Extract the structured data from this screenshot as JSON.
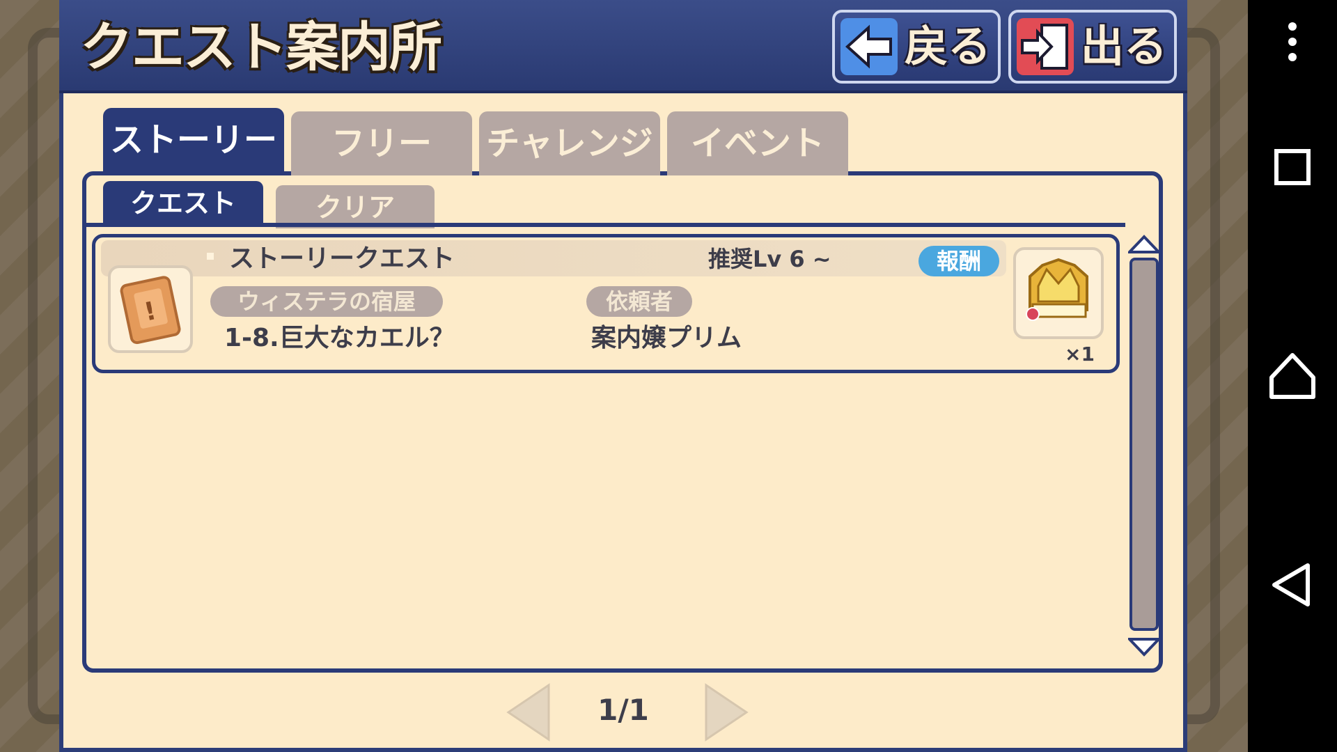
{
  "header": {
    "title": "クエスト案内所",
    "back_label": "戻る",
    "exit_label": "出る"
  },
  "tabs": [
    "ストーリー",
    "フリー",
    "チャレンジ",
    "イベント"
  ],
  "subtabs": [
    "クエスト",
    "クリア"
  ],
  "quests": [
    {
      "type": "ストーリークエスト",
      "recommended_level": "推奨Lv 6 ~",
      "reward_label": "報酬",
      "location": "ウィステラの宿屋",
      "client_label": "依頼者",
      "name": "1-8.巨大なカエル？",
      "client": "案内嬢プリム",
      "reward_count": "×1"
    }
  ],
  "pager": {
    "label": "1/1"
  },
  "colors": {
    "panel_bg": "#fdebc9",
    "accent_navy": "#2a3a78",
    "inactive_tab": "#b5a7a3",
    "reward_badge": "#4aa7df",
    "back_icon": "#4f8fe6",
    "exit_icon": "#e24c55"
  },
  "icons": [
    "back-arrow-icon",
    "exit-door-icon",
    "quest-scroll-icon",
    "choco-crown-reward-icon",
    "scroll-up-arrow-icon",
    "scroll-down-arrow-icon",
    "prev-page-arrow-icon",
    "next-page-arrow-icon",
    "overflow-menu-icon",
    "recent-apps-icon",
    "home-icon",
    "back-nav-icon"
  ]
}
